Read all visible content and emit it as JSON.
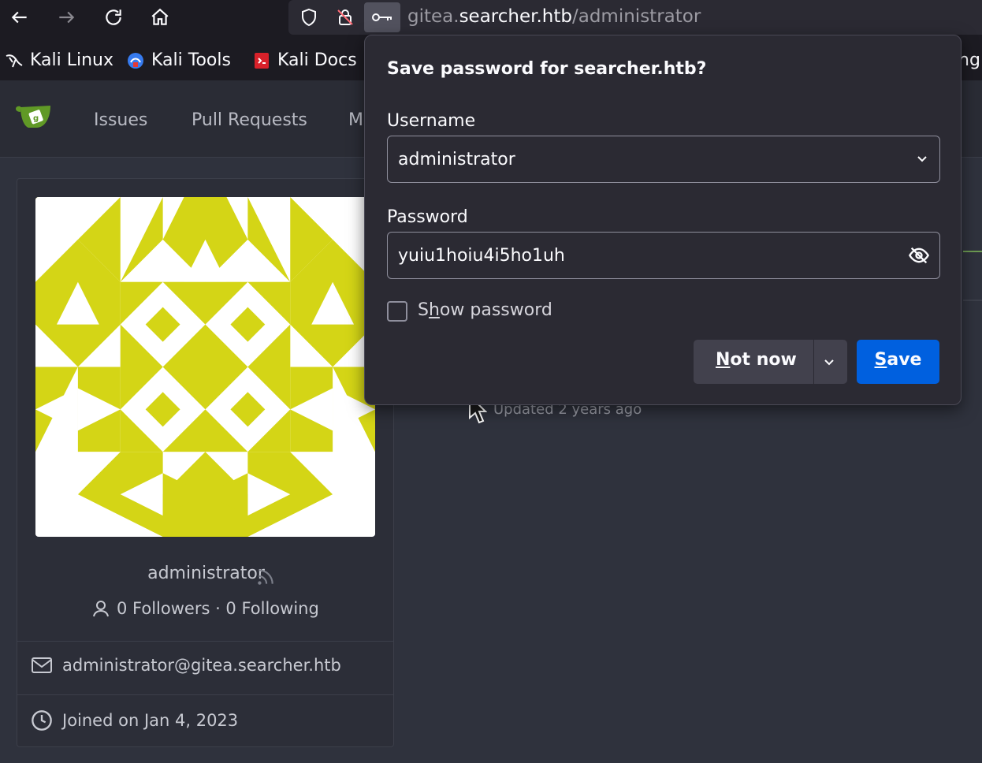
{
  "browser": {
    "url_prefix": "gitea.",
    "url_host": "searcher.htb",
    "url_path": "/administrator"
  },
  "bookmarks": [
    {
      "label": "Kali Linux"
    },
    {
      "label": "Kali Tools"
    },
    {
      "label": "Kali Docs"
    }
  ],
  "bookmark_overflow_text": "ng",
  "gitea_nav": {
    "items": [
      {
        "label": "Issues"
      },
      {
        "label": "Pull Requests"
      },
      {
        "label": "M"
      }
    ]
  },
  "profile": {
    "username": "administrator",
    "followers_text": "0 Followers · 0 Following",
    "email": "administrator@gitea.searcher.htb",
    "joined": "Joined on Jan 4, 2023",
    "avatar_color": "#d4d516"
  },
  "repo": {
    "updated": "Updated 2 years ago"
  },
  "password_popup": {
    "title": "Save password for searcher.htb?",
    "username_label": "Username",
    "username_value": "administrator",
    "password_label": "Password",
    "password_value": "yuiu1hoiu4i5ho1uh",
    "show_password_prefix": "S",
    "show_password_underlined": "h",
    "show_password_rest": "ow password",
    "not_now_underlined": "N",
    "not_now_rest": "ot now",
    "save_underlined": "S",
    "save_rest": "ave"
  },
  "colors": {
    "accent": "#0060df",
    "toolbar": "#1c1b22",
    "popup": "#2b2a33",
    "gitea_green": "#609926"
  }
}
